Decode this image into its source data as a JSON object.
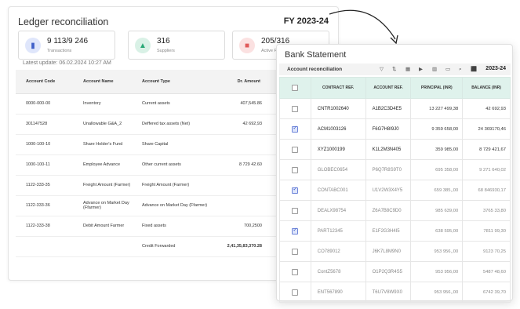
{
  "ledger": {
    "title": "Ledger reconciliation",
    "fy": "FY 2023-24",
    "stats": [
      {
        "value": "9 113/9 246",
        "label": "Transactions",
        "icon": "book-icon",
        "color": "#3f5fc9"
      },
      {
        "value": "316",
        "label": "Suppliers",
        "icon": "warning-icon",
        "color": "#2aa877"
      },
      {
        "value": "205/316",
        "label": "Active F",
        "icon": "minus-icon",
        "color": "#e05a5a"
      }
    ],
    "latest_update": "Latest update:   06.02.2024 10:27 AM",
    "columns": [
      "Account Code",
      "Account Name",
      "Account Type",
      "Dr. Amount"
    ],
    "rows": [
      {
        "code": "0000-000-00",
        "name": "Inventory",
        "type": "Current assets",
        "amount": "407,545.86"
      },
      {
        "code": "301147528",
        "name": "Unallowable G&A_2",
        "type": "Deffered tax assets (Net)",
        "amount": "42 692,93"
      },
      {
        "code": "1000-100-10",
        "name": "Share Holder's Fund",
        "type": "Share Capital",
        "amount": ""
      },
      {
        "code": "1000-100-11",
        "name": "Employee Advance",
        "type": "Other current assets",
        "amount": "8 729 42.60"
      },
      {
        "code": "1122-333-35",
        "name": "Freight Amount (Farmer)",
        "type": "Freight Amount (Farmer)",
        "amount": ""
      },
      {
        "code": "1122-333-36",
        "name": "Advance on Market Day (Ffarmer)",
        "type": "Advance on Market Day (Ffarmer)",
        "amount": ""
      },
      {
        "code": "1122-333-38",
        "name": "Debit Amount Farmer",
        "type": "Fixed assets",
        "amount": "700,2500"
      },
      {
        "code": "",
        "name": "",
        "type": "Credit Forwarded",
        "amount": "2,41,35,83,370.28"
      }
    ]
  },
  "bank": {
    "title": "Bank Statement",
    "subtitle": "Account reconciliation",
    "year": "2023-24",
    "toolbar_icons": [
      "filter-icon",
      "sort-icon",
      "calendar-icon",
      "play-icon",
      "chart-icon",
      "folder-icon",
      "search-icon",
      "download-icon"
    ],
    "columns": [
      "CONTRACT REF.",
      "ACCOUNT REF.",
      "PRINCIPAL (INR)",
      "BALANCE (INR)"
    ],
    "rows": [
      {
        "checked": false,
        "contract": "CNTR1002640",
        "account": "A1B2C3D4E5",
        "principal": "13 227 499,38",
        "balance": "42 692,93",
        "faded": false
      },
      {
        "checked": true,
        "contract": "ACM1003126",
        "account": "F6G7H8I9J0",
        "principal": "9 359 658,00",
        "balance": "24 369170,46",
        "faded": false
      },
      {
        "checked": false,
        "contract": "XYZ1000199",
        "account": "K1L2M3N405",
        "principal": "359 985,00",
        "balance": "8 729 421,67",
        "faded": false
      },
      {
        "checked": false,
        "contract": "GLOBEC0654",
        "account": "P6Q7R8S9T0",
        "principal": "695 358,00",
        "balance": "9 271 640,02",
        "faded": true
      },
      {
        "checked": true,
        "contract": "CONTABC001",
        "account": "U1V2W3X4Y5",
        "principal": "659 385,,00",
        "balance": "68 846930,17",
        "faded": true
      },
      {
        "checked": false,
        "contract": "DEALX98754",
        "account": "Z6A7B8C9D0",
        "principal": "985 639,00",
        "balance": "3765 33,80",
        "faded": true
      },
      {
        "checked": true,
        "contract": "PART12345",
        "account": "E1F2G3H4I5",
        "principal": "638 595,00",
        "balance": "7811 99,30",
        "faded": true
      },
      {
        "checked": false,
        "contract": "CO789012",
        "account": "J6K7L8M9N0",
        "principal": "953 956,,00",
        "balance": "9123 70,25",
        "faded": true
      },
      {
        "checked": false,
        "contract": "ContZ5678",
        "account": "O1P2Q3R4S5",
        "principal": "953 956,00",
        "balance": "5487 48,60",
        "faded": true
      },
      {
        "checked": false,
        "contract": "ENT567890",
        "account": "T6U7V8W9X0",
        "principal": "953 956,,00",
        "balance": "6742 39,70",
        "faded": true
      }
    ]
  }
}
